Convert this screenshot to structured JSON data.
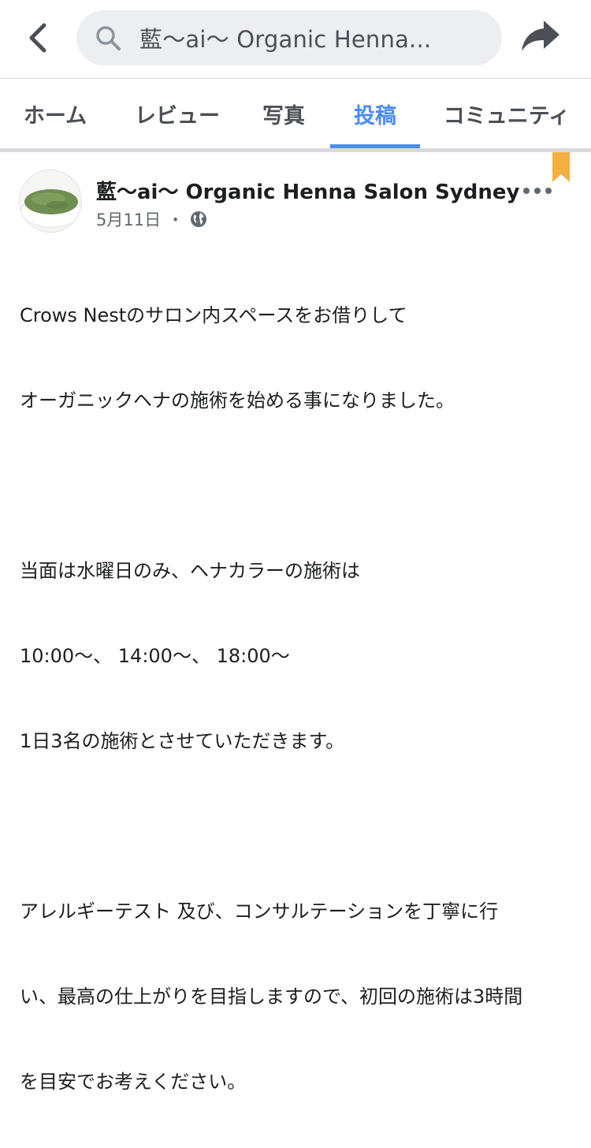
{
  "header": {
    "search_text": "藍〜ai〜 Organic Henna...",
    "back_icon": "chevron-left-icon",
    "search_icon": "search-icon",
    "share_icon": "share-arrow-icon"
  },
  "tabs": [
    {
      "label": "ホーム",
      "active": false
    },
    {
      "label": "レビュー",
      "active": false
    },
    {
      "label": "写真",
      "active": false
    },
    {
      "label": "投稿",
      "active": true
    },
    {
      "label": "コミュニティ",
      "active": false
    }
  ],
  "colors": {
    "accent": "#4a8cf7",
    "bookmark": "#f5b042",
    "search_bg": "#eceef2",
    "text": "#1c1e21",
    "muted": "#606770"
  },
  "post": {
    "page_name": "藍〜ai〜 Organic Henna Salon Sydney",
    "date": "5月11日",
    "separator": "・",
    "privacy_icon": "globe-icon",
    "lines": [
      "Crows Nestのサロン内スペースをお借りして",
      "オーガニックヘナの施術を始める事になりました。",
      "",
      "当面は水曜日のみ、ヘナカラーの施術は",
      "10:00〜、 14:00〜、 18:00〜",
      "1日3名の施術とさせていただきます。",
      "",
      "アレルギーテスト 及び、コンサルテーションを丁寧に行",
      "い、最高の仕上がりを目指しますので、初回の施術は3時間",
      "を目安でお考えください。"
    ]
  }
}
